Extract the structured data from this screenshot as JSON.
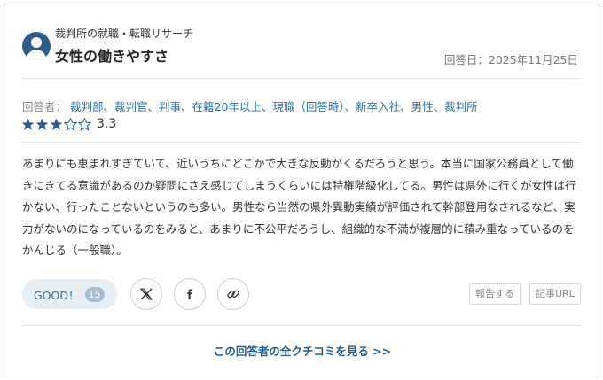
{
  "review": {
    "company": "裁判所の就職・転職リサーチ",
    "title": "女性の働きやすさ",
    "answer_date": "回答日：2025年11月25日",
    "respondent_label": "回答者：",
    "respondent_value": "裁判部、裁判官、判事、在籍20年以上、現職（回答時）、新卒入社、男性、裁判所",
    "rating": 3.3,
    "rating_text": "3.3",
    "body": "あまりにも恵まれすぎていて、近いうちにどこかで大きな反動がくるだろうと思う。本当に国家公務員として働きにきてる意識があるのか疑問にさえ感じてしまうくらいには特権階級化してる。男性は県外に行くが女性は行かない、行ったことないというのも多い。男性なら当然の県外異動実績が評価されて幹部登用なされるなど、実力がないのになっているのをみると、あまりに不公平だろうし、組織的な不満が複層的に積み重なっているのをかんじる（一般職）。"
  },
  "actions": {
    "good_label": "GOOD！",
    "good_count": "15",
    "share_icons": [
      "x-icon",
      "facebook-icon",
      "link-icon"
    ],
    "report_label": "報告する",
    "url_label": "記事URL",
    "more_label": "この回答者の全クチコミを見る >>"
  },
  "colors": {
    "accent": "#2a6fa8",
    "avatar": "#2f5d86",
    "good_bg": "#e7eef4",
    "star": "#2f5d86"
  }
}
